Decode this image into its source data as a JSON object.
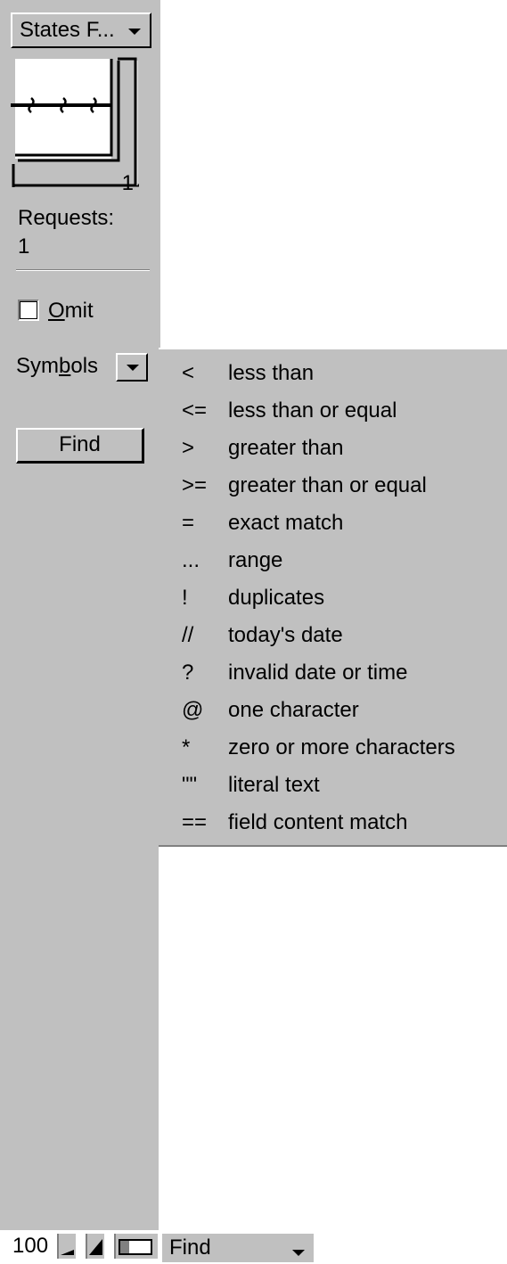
{
  "layout_menu": {
    "label": "States F...",
    "icon": "chevron-down-icon"
  },
  "book": {
    "icon": "book-icon",
    "page_number": "1"
  },
  "requests": {
    "label": "Requests:",
    "count": "1"
  },
  "omit": {
    "label": "Omit",
    "checked": false
  },
  "symbols": {
    "label": "Symbols",
    "icon": "chevron-down-icon"
  },
  "find_button": {
    "label": "Find"
  },
  "symbols_menu": {
    "items": [
      {
        "symbol": "<",
        "description": "less than"
      },
      {
        "symbol": "<=",
        "description": "less than or equal"
      },
      {
        "symbol": ">",
        "description": "greater than"
      },
      {
        "symbol": ">=",
        "description": "greater than or equal"
      },
      {
        "symbol": "=",
        "description": "exact match"
      },
      {
        "symbol": "...",
        "description": "range"
      },
      {
        "symbol": "!",
        "description": "duplicates"
      },
      {
        "symbol": "//",
        "description": "today's date"
      },
      {
        "symbol": "?",
        "description": "invalid date or time"
      },
      {
        "symbol": "@",
        "description": "one character"
      },
      {
        "symbol": "*",
        "description": "zero or more characters"
      },
      {
        "symbol": "\"\"",
        "description": "literal text"
      },
      {
        "symbol": "==",
        "description": "field content match"
      }
    ]
  },
  "statusbar": {
    "zoom": "100",
    "zoom_out_icon": "zoom-out-icon",
    "zoom_in_icon": "zoom-in-icon",
    "view_toggle_icon": "status-area-toggle-icon",
    "mode": "Find"
  },
  "colors": {
    "panel": "#c0c0c0",
    "background": "#ffffff"
  }
}
